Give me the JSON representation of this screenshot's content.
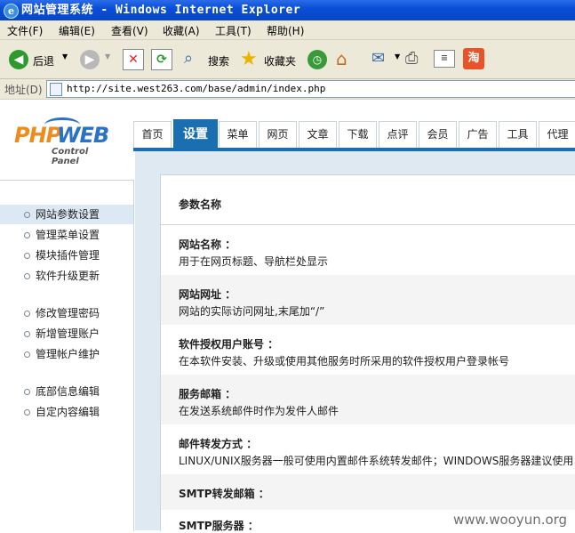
{
  "window": {
    "title": "网站管理系统 - Windows Internet Explorer"
  },
  "menu": {
    "items": [
      "文件(F)",
      "编辑(E)",
      "查看(V)",
      "收藏(A)",
      "工具(T)",
      "帮助(H)"
    ]
  },
  "toolbar": {
    "back_label": "后退",
    "search_label": "搜索",
    "favorites_label": "收藏夹"
  },
  "address": {
    "label": "地址(D)",
    "url": "http://site.west263.com/base/admin/index.php"
  },
  "logo": {
    "brand_a": "PHP",
    "brand_b": "WEB",
    "subtitle": "Control Panel"
  },
  "nav": {
    "tabs": [
      "首页",
      "设置",
      "菜单",
      "网页",
      "文章",
      "下载",
      "点评",
      "会员",
      "广告",
      "工具",
      "代理"
    ],
    "active": "设置"
  },
  "sidebar": {
    "items": [
      "网站参数设置",
      "管理菜单设置",
      "模块插件管理",
      "软件升级更新",
      "修改管理密码",
      "新增管理账户",
      "管理帐户维护",
      "底部信息编辑",
      "自定内容编辑"
    ]
  },
  "main": {
    "header": "参数名称",
    "rows": [
      {
        "name": "网站名称 ：",
        "desc": "用于在网页标题、导航栏处显示"
      },
      {
        "name": "网站网址 ：",
        "desc": "网站的实际访问网址,末尾加“/”"
      },
      {
        "name": "软件授权用户账号 ：",
        "desc": "在本软件安装、升级或使用其他服务时所采用的软件授权用户登录帐号"
      },
      {
        "name": "服务邮箱 ：",
        "desc": "在发送系统邮件时作为发件人邮件"
      },
      {
        "name": "邮件转发方式 ：",
        "desc": "LINUX/UNIX服务器一般可使用内置邮件系统转发邮件；WINDOWS服务器建议使用"
      },
      {
        "name": "SMTP转发邮箱 ：",
        "desc": ""
      },
      {
        "name": "SMTP服务器 ：",
        "desc": ""
      }
    ]
  },
  "watermark": "www.wooyun.org",
  "colors": {
    "accent": "#1a6fb0",
    "titlebar": "#0a4fd6",
    "sidebar_active": "#dce8f4"
  }
}
